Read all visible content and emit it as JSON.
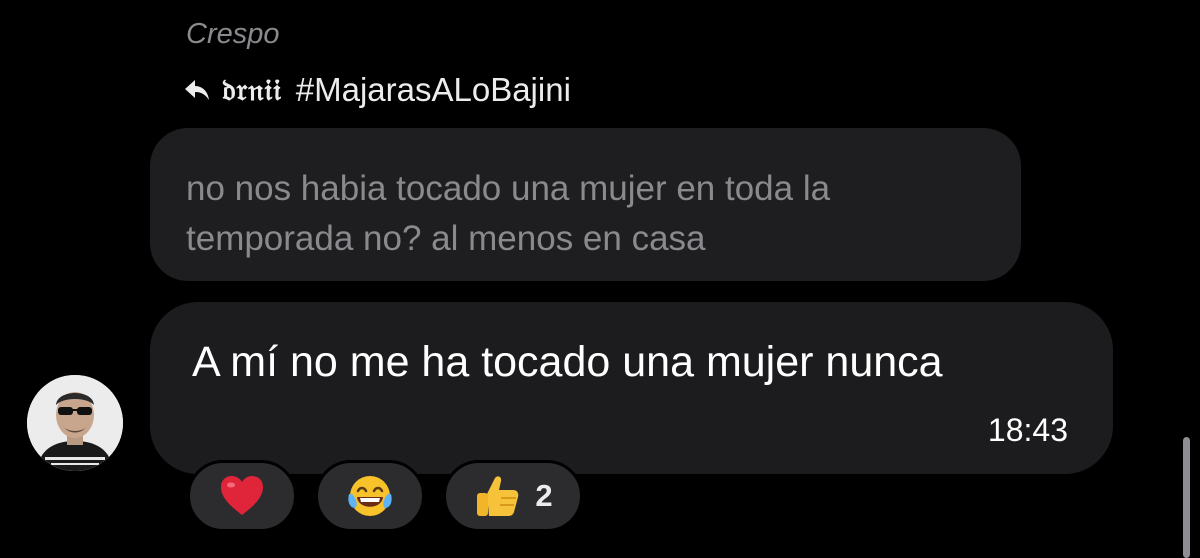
{
  "message_group": {
    "sender_name": "Crespo",
    "reply_to": {
      "icon": "reply-arrow-icon",
      "user": "𝔡𝔯𝔫𝔦𝔦",
      "hashtag": "#MajarasALoBajini",
      "quoted_lines": [
        "no nos habia tocado una mujer en toda la",
        "temporada no? al menos en casa"
      ]
    },
    "message": {
      "text": "A mí no me ha tocado una mujer nunca",
      "time": "18:43"
    },
    "avatar": {
      "icon": "avatar-photo",
      "caption_text": ""
    },
    "reactions": [
      {
        "emoji": "heart",
        "count": ""
      },
      {
        "emoji": "face-with-tears-of-joy",
        "count": ""
      },
      {
        "emoji": "thumbs-up",
        "count": "2"
      }
    ]
  },
  "colors": {
    "background": "#000000",
    "bubble": "#1c1c1e",
    "quoted_bubble": "#1e1e20",
    "muted_text": "#8a8a8e",
    "reaction_pill": "#2c2c2e"
  }
}
